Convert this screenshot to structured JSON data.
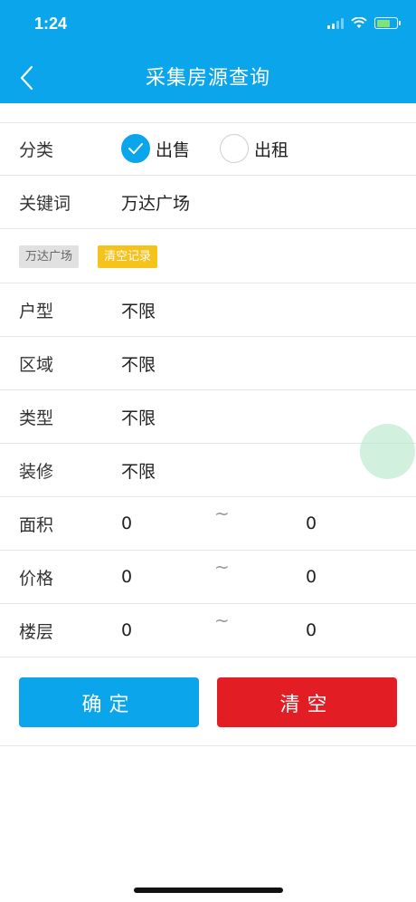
{
  "status_bar": {
    "time": "1:24"
  },
  "header": {
    "title": "采集房源查询"
  },
  "category": {
    "label": "分类",
    "options": [
      {
        "label": "出售",
        "checked": true
      },
      {
        "label": "出租",
        "checked": false
      }
    ]
  },
  "keyword": {
    "label": "关键词",
    "value": "万达广场"
  },
  "tags": {
    "history": "万达广场",
    "clear": "清空记录"
  },
  "filters": [
    {
      "label": "户型",
      "value": "不限"
    },
    {
      "label": "区域",
      "value": "不限"
    },
    {
      "label": "类型",
      "value": "不限"
    },
    {
      "label": "装修",
      "value": "不限"
    }
  ],
  "ranges": [
    {
      "label": "面积",
      "from": "0",
      "sep": "~",
      "to": "0"
    },
    {
      "label": "价格",
      "from": "0",
      "sep": "~",
      "to": "0"
    },
    {
      "label": "楼层",
      "from": "0",
      "sep": "~",
      "to": "0"
    }
  ],
  "buttons": {
    "confirm": "确定",
    "clear": "清空"
  },
  "colors": {
    "accent": "#0aa5ea",
    "danger": "#e31d24",
    "tag_yellow": "#f6c21c"
  }
}
